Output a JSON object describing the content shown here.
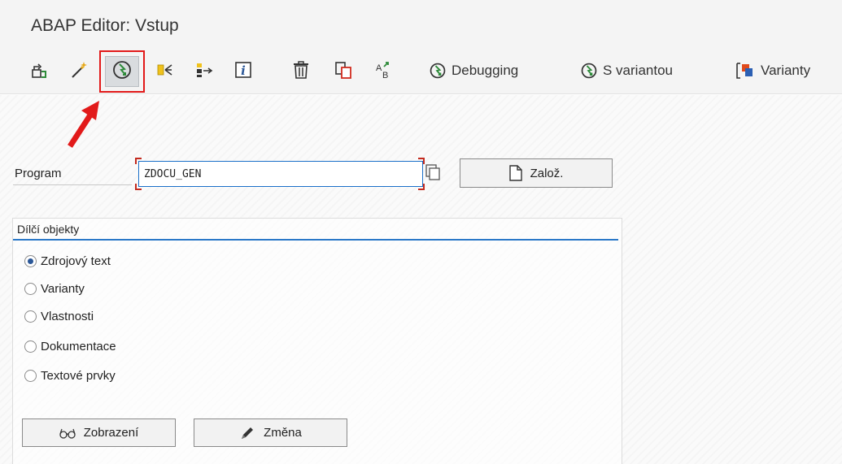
{
  "window": {
    "title": "ABAP Editor: Vstup"
  },
  "toolbar": {
    "icons": [
      "other-object-icon",
      "wizard-icon",
      "execute-icon",
      "where-used-icon",
      "object-list-icon",
      "info-icon",
      "delete-icon",
      "copy-icon",
      "rename-icon"
    ],
    "debugging_label": "Debugging",
    "with_variant_label": "S variantou",
    "variants_label": "Varianty",
    "highlight_color": "#e21a1a"
  },
  "form": {
    "program_label": "Program",
    "program_value": "ZDOCU_GEN",
    "create_label": "Založ."
  },
  "subobjects": {
    "title": "Dílčí objekty",
    "options": [
      {
        "label": "Zdrojový text",
        "checked": true
      },
      {
        "label": "Varianty",
        "checked": false
      },
      {
        "label": "Vlastnosti",
        "checked": false
      },
      {
        "label": "Dokumentace",
        "checked": false
      },
      {
        "label": "Textové prvky",
        "checked": false
      }
    ],
    "display_label": "Zobrazení",
    "change_label": "Změna"
  },
  "colors": {
    "accent_blue": "#2a78c8",
    "annotation_red": "#e21a1a",
    "field_bracket_red": "#c32b1f"
  }
}
